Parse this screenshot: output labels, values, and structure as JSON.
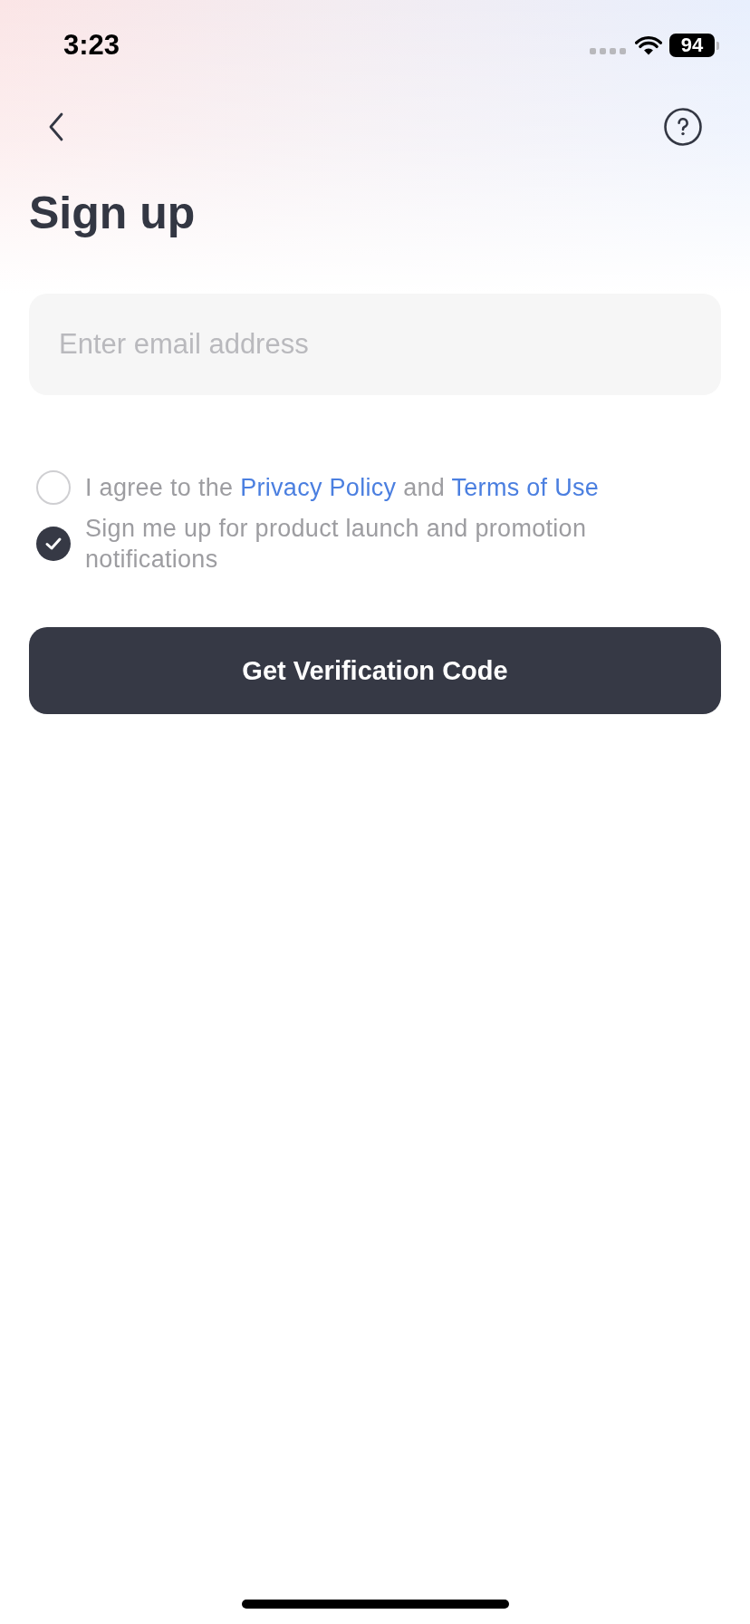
{
  "status_bar": {
    "time": "3:23",
    "battery": "94"
  },
  "header": {
    "title": "Sign up"
  },
  "email_field": {
    "placeholder": "Enter email address"
  },
  "consents": [
    {
      "checked": false,
      "segments": [
        {
          "kind": "text",
          "text": "I agree to the"
        },
        {
          "kind": "link",
          "text": "Privacy Policy"
        },
        {
          "kind": "text",
          "text": "and"
        },
        {
          "kind": "link",
          "text": "Terms of Use"
        }
      ]
    },
    {
      "checked": true,
      "segments": [
        {
          "kind": "text",
          "text": "Sign me up for product launch and promotion notifications"
        }
      ]
    }
  ],
  "submit_button": {
    "label": "Get Verification Code"
  }
}
